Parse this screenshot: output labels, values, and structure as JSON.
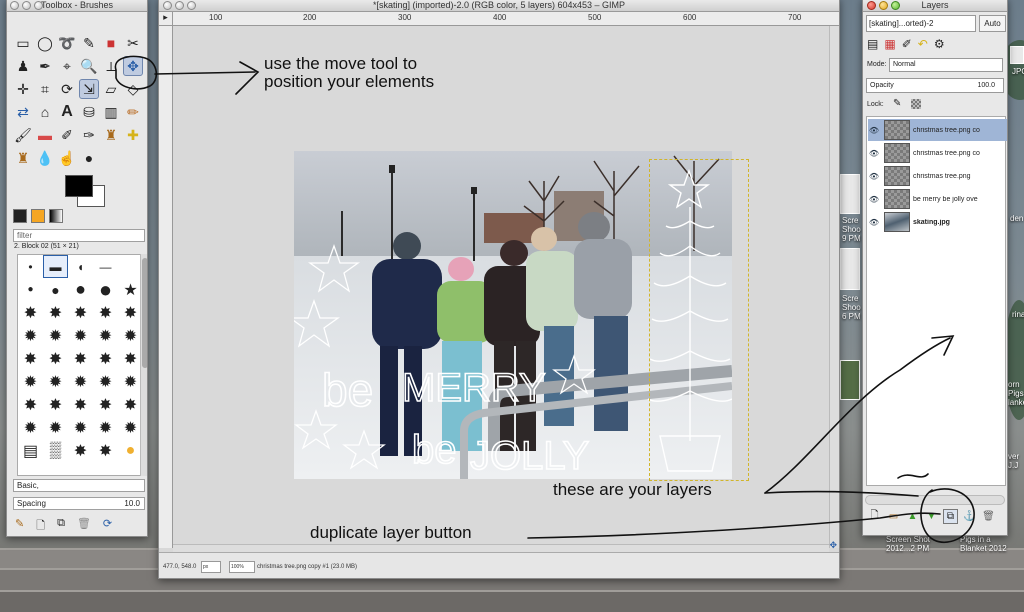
{
  "toolbox": {
    "title": "Toolbox - Brushes",
    "filter_placeholder": "filter",
    "brush_name": "2. Block 02 (51 × 21)",
    "brush_set": "Basic,",
    "spacing_label": "Spacing",
    "spacing_value": "10.0"
  },
  "image_window": {
    "title": "*[skating] (imported)-2.0 (RGB color, 5 layers) 604x453 – GIMP",
    "ruler_ticks": [
      "100",
      "200",
      "300",
      "400",
      "500",
      "600",
      "700"
    ],
    "status_coords": "477.0, 548.0",
    "status_unit": "px",
    "status_zoom": "100%",
    "status_text": "christmas tree.png copy #1 (23.0 MB)",
    "overlay_text": {
      "be": "be",
      "merry": "MERRY",
      "be2": "be",
      "jolly": "JOLLY"
    }
  },
  "layers_window": {
    "title": "Layers",
    "image_selector": "[skating]...orted)-2",
    "auto_button": "Auto",
    "mode_label": "Mode:",
    "mode_value": "Normal",
    "opacity_label": "Opacity",
    "opacity_value": "100.0",
    "lock_label": "Lock:",
    "layers": [
      {
        "name": "christmas tree.png co",
        "bold": false,
        "selected": true
      },
      {
        "name": "christmas tree.png co",
        "bold": false,
        "selected": false
      },
      {
        "name": "christmas tree.png",
        "bold": false,
        "selected": false
      },
      {
        "name": "be merry be jolly ove",
        "bold": false,
        "selected": false
      },
      {
        "name": "skating.jpg",
        "bold": true,
        "selected": false
      }
    ]
  },
  "desktop": {
    "labels": [
      {
        "text": "JPG"
      },
      {
        "text": "Scre\nShoo\n9 PM"
      },
      {
        "text": "Scre\nShoo\n6 PM"
      },
      {
        "text": "den"
      },
      {
        "text": "rina"
      },
      {
        "text": "orn\nPigs\nlanke"
      },
      {
        "text": "ver\nJ.J"
      },
      {
        "text": "Screen Shot\n2012...2 PM"
      },
      {
        "text": "Pigs in a\nBlanket 2012"
      }
    ]
  },
  "annotations": {
    "move_tool": "use the move tool to\nposition your elements",
    "layers": "these are your layers",
    "duplicate": "duplicate layer button"
  }
}
